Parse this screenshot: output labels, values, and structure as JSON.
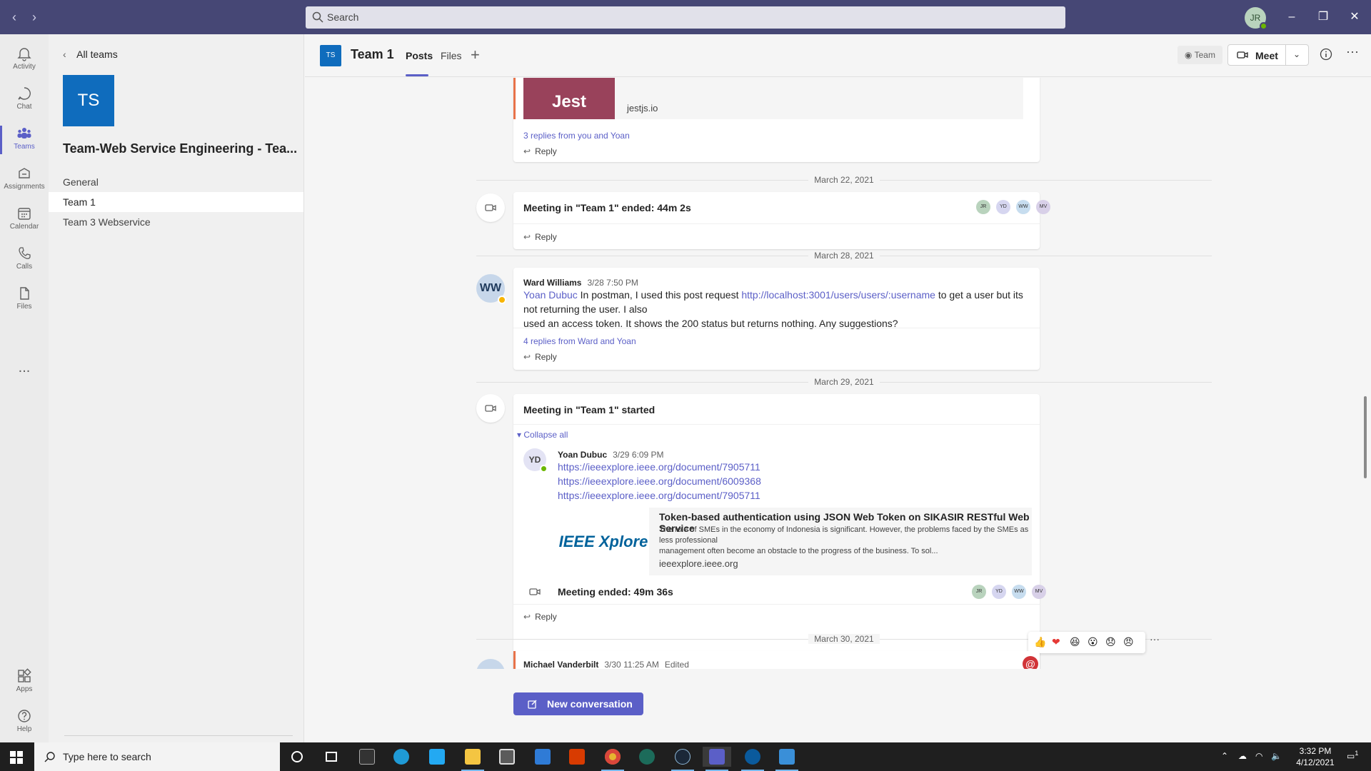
{
  "titlebar": {
    "search_placeholder": "Search",
    "user_initials": "JR",
    "user_status_color": "#6bb700"
  },
  "appbar": {
    "items": [
      {
        "label": "Activity",
        "icon": "bell-icon"
      },
      {
        "label": "Chat",
        "icon": "chat-icon"
      },
      {
        "label": "Teams",
        "icon": "teams-icon"
      },
      {
        "label": "Assignments",
        "icon": "assignments-icon"
      },
      {
        "label": "Calendar",
        "icon": "calendar-icon"
      },
      {
        "label": "Calls",
        "icon": "phone-icon"
      },
      {
        "label": "Files",
        "icon": "file-icon"
      }
    ],
    "more": "...",
    "bottom": [
      {
        "label": "Apps",
        "icon": "apps-icon"
      },
      {
        "label": "Help",
        "icon": "help-icon"
      }
    ],
    "active_color": "#5b5fc7"
  },
  "team_panel": {
    "back_label": "All teams",
    "team_initials": "TS",
    "team_name": "Team-Web Service Engineering - Tea...",
    "channels": [
      "General",
      "Team 1",
      "Team 3 Webservice"
    ],
    "active_channel": "Team 1"
  },
  "header": {
    "logo_initials": "TS",
    "title": "Team 1",
    "tabs": [
      "Posts",
      "Files"
    ],
    "active_tab": "Posts",
    "team_chip": "Team",
    "meet_label": "Meet"
  },
  "feed": {
    "preview_card": {
      "image_title": "Jest",
      "domain": "jestjs.io",
      "replies": "3 replies from you and Yoan",
      "reply_label": "Reply"
    },
    "dates": [
      "March 22, 2021",
      "March 28, 2021",
      "March 29, 2021",
      "March 30, 2021"
    ],
    "meeting_ended": {
      "text": "Meeting in \"Team 1\" ended: 44m 2s",
      "participants": [
        "JR",
        "YD",
        "WW",
        "MV"
      ],
      "reply_label": "Reply"
    },
    "ward_post": {
      "initials": "WW",
      "sender": "Ward Williams",
      "time": "3/28 7:50 PM",
      "mention": "Yoan Dubuc",
      "text_before_link": " In postman, I used this post request ",
      "link": "http://localhost:3001/users/users/:username",
      "text_after_link": " to get a user but its not returning the user. I also",
      "text_line2": "used an access token. It shows the 200 status but returns nothing. Any suggestions?",
      "replies": "4 replies from Ward and Yoan",
      "reply_label": "Reply",
      "status_color": "#f8b400"
    },
    "meeting_started": {
      "text": "Meeting in \"Team 1\" started",
      "collapse_label": "Collapse all",
      "reply": {
        "initials": "YD",
        "sender": "Yoan Dubuc",
        "time": "3/29 6:09 PM",
        "links": [
          "https://ieeexplore.ieee.org/document/7905711",
          "https://ieeexplore.ieee.org/document/6009368",
          "https://ieeexplore.ieee.org/document/7905711"
        ],
        "status_color": "#6bb700"
      },
      "link_preview": {
        "logo_text": "IEEE Xplore",
        "title": "Token-based authentication using JSON Web Token on SIKASIR RESTful Web Service",
        "description_line1": "The role of SMEs in the economy of Indonesia is significant. However, the problems faced by the SMEs as less professional",
        "description_line2": "management often become an obstacle to the progress of the business. To sol...",
        "domain": "ieeexplore.ieee.org"
      },
      "ended_text": "Meeting ended: 49m 36s",
      "participants": [
        "JR",
        "YD",
        "WW",
        "MV"
      ],
      "reply_label": "Reply"
    },
    "michael_post": {
      "sender": "Michael Vanderbilt",
      "time": "3/30 11:25 AM",
      "edited": "Edited"
    },
    "reactions": [
      "👍",
      "❤",
      "😆",
      "😮",
      "😞",
      "😠"
    ],
    "new_conversation": "New conversation"
  },
  "taskbar": {
    "search_placeholder": "Type here to search",
    "time": "3:32 PM",
    "date": "4/12/2021",
    "notification_count": "1"
  }
}
